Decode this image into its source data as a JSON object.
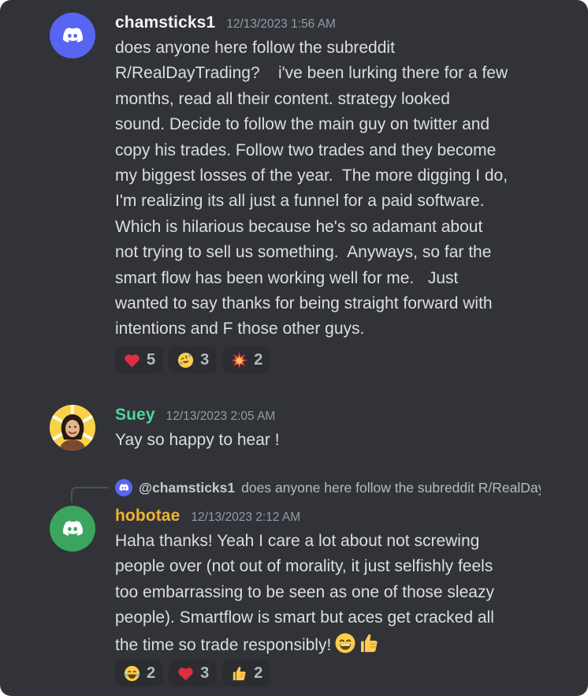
{
  "colors": {
    "background": "#313338",
    "text": "#dbdee1",
    "timestamp": "#949ba4",
    "discord_blurple": "#5865f2",
    "discord_green": "#3ba55d",
    "username_default": "#f2f3f5",
    "username_suey": "#4fd69c",
    "username_hobotae": "#f0b232",
    "reaction_bg": "#2b2d31"
  },
  "messages": [
    {
      "username": "chamsticks1",
      "timestamp": "12/13/2023 1:56 AM",
      "avatar_icon": "discord-logo-icon",
      "lines": [
        "does anyone here follow the subreddit",
        "R/RealDayTrading?    i've been lurking there for a few",
        "months, read all their content. strategy looked",
        "sound. Decide to follow the main guy on twitter and",
        "copy his trades. Follow two trades and they become",
        "my biggest losses of the year.  The more digging I do,",
        "I'm realizing its all just a funnel for a paid software.",
        "Which is hilarious because he's so adamant about",
        "not trying to sell us something.  Anyways, so far the",
        "smart flow has been working well for me.   Just",
        "wanted to say thanks for being straight forward with",
        "intentions and F those other guys."
      ],
      "reactions": [
        {
          "emoji": "red-heart",
          "count": "5"
        },
        {
          "emoji": "rolling-on-floor-laughing",
          "count": "3"
        },
        {
          "emoji": "collision",
          "count": "2"
        }
      ]
    },
    {
      "username": "Suey",
      "timestamp": "12/13/2023 2:05 AM",
      "avatar_icon": "user-photo-avatar",
      "lines": [
        "Yay so happy to hear !"
      ]
    },
    {
      "reply_to": {
        "mention": "@chamsticks1",
        "snippet": "does anyone here follow the subreddit R/RealDayTrading?"
      },
      "username": "hobotae",
      "timestamp": "12/13/2023 2:12 AM",
      "avatar_icon": "discord-logo-icon",
      "lines": [
        "Haha thanks! Yeah I care a lot about not screwing",
        "people over (not out of morality, it just selfishly feels",
        "too embarrassing to be seen as one of those sleazy",
        "people). Smartflow is smart but aces get cracked all",
        "the time so trade responsibly!"
      ],
      "trailing_emojis": [
        "grinning-face-with-smiling-eyes",
        "thumbs-up"
      ],
      "reactions": [
        {
          "emoji": "face-with-tears-of-joy",
          "count": "2"
        },
        {
          "emoji": "red-heart",
          "count": "3"
        },
        {
          "emoji": "thumbs-up",
          "count": "2"
        }
      ]
    }
  ]
}
